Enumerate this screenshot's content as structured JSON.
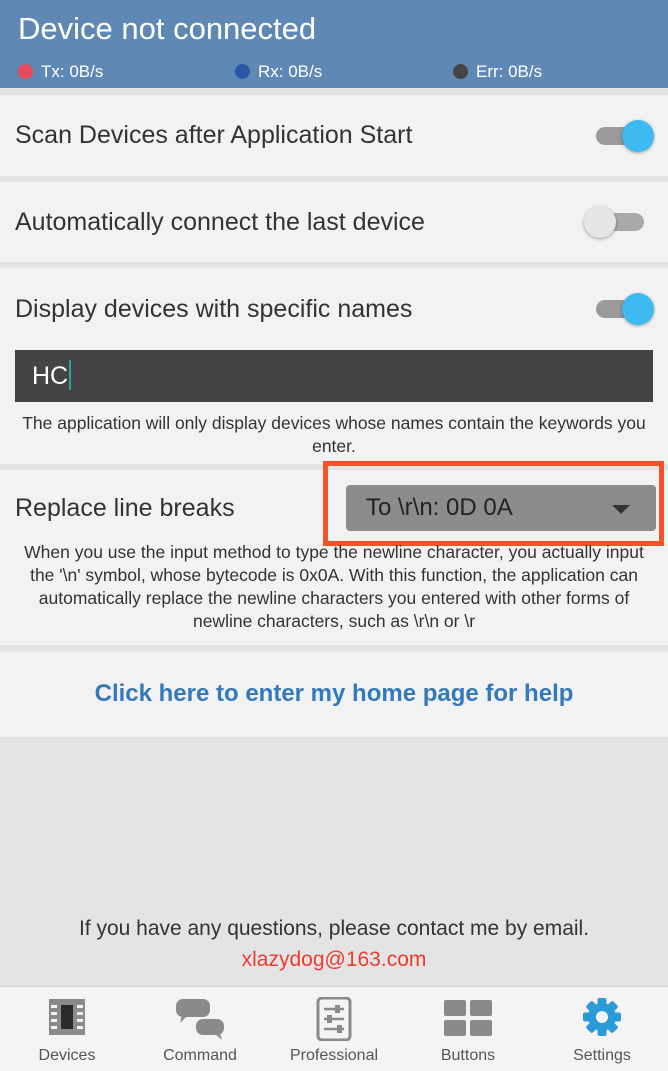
{
  "header": {
    "title": "Device not connected",
    "tx": "Tx: 0B/s",
    "rx": "Rx: 0B/s",
    "err": "Err: 0B/s",
    "tx_color": "#e84a5a",
    "rx_color": "#2a58a8",
    "err_color": "#444444"
  },
  "settings": {
    "scan_on_start": {
      "label": "Scan Devices after Application Start",
      "enabled": true
    },
    "auto_connect": {
      "label": "Automatically connect the last device",
      "enabled": false
    },
    "name_filter": {
      "label": "Display devices with specific names",
      "enabled": true,
      "value": "HC",
      "hint": "The application will only display devices whose names contain the keywords you enter."
    },
    "line_breaks": {
      "label": "Replace line breaks",
      "selected": "To \\r\\n: 0D 0A",
      "hint": "When you use the input method to type the newline character, you actually input the '\\n' symbol, whose bytecode is 0x0A. With this function, the application can automatically replace the newline characters you entered with other forms of newline characters, such as \\r\\n or \\r"
    }
  },
  "help_link": "Click here to enter my home page for help",
  "contact": {
    "text": "If you have any questions, please contact me by email.",
    "email": "xlazydog@163.com",
    "email_color": "#ee3b2e"
  },
  "nav": [
    {
      "label": "Devices",
      "icon": "chip-icon"
    },
    {
      "label": "Command",
      "icon": "chat-icon"
    },
    {
      "label": "Professional",
      "icon": "sliders-icon"
    },
    {
      "label": "Buttons",
      "icon": "grid-icon"
    },
    {
      "label": "Settings",
      "icon": "gear-icon",
      "active": true
    }
  ],
  "accent_color": "#3dbaf0"
}
